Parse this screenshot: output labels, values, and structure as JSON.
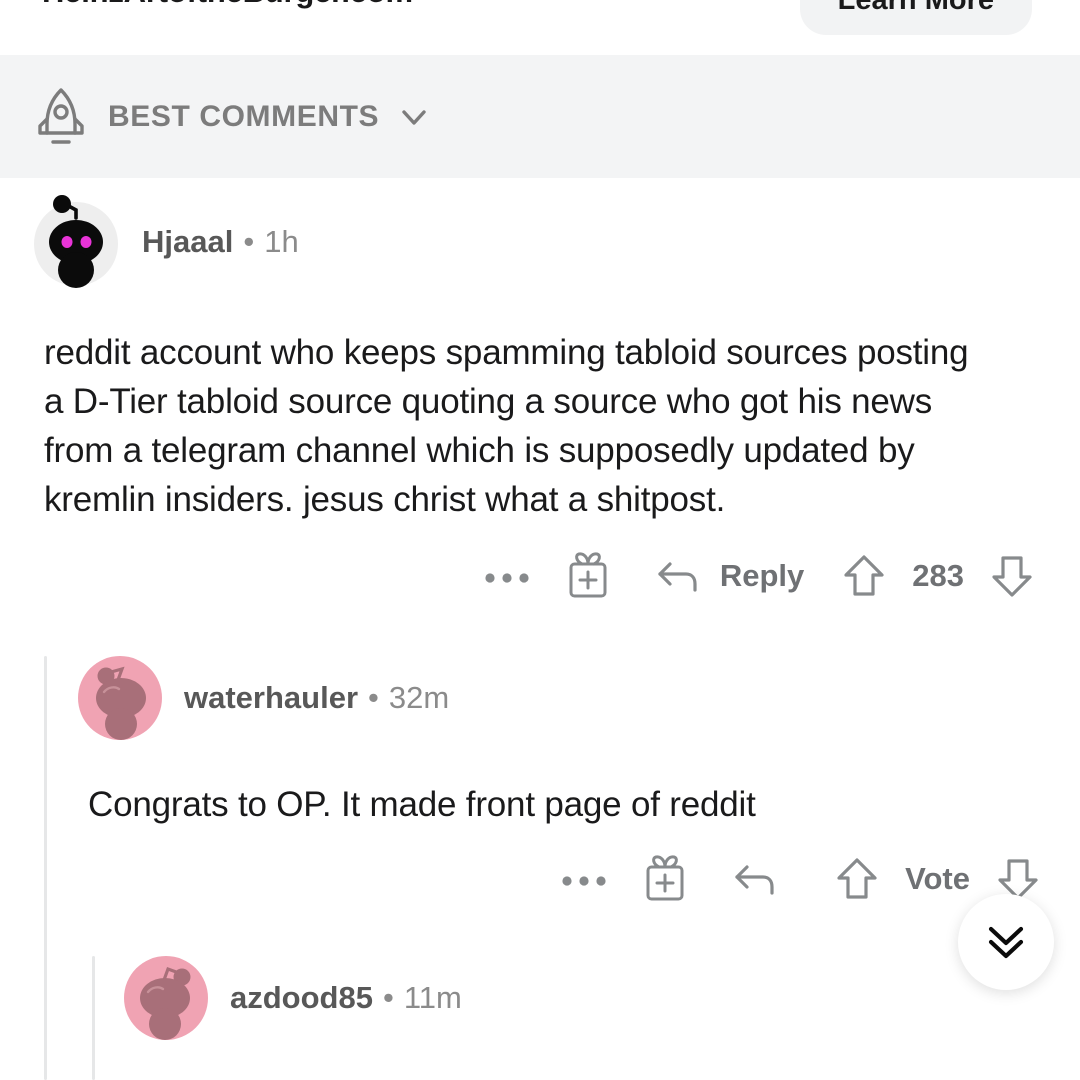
{
  "promo": {
    "domain": "HeinzArtoftheBurger.com",
    "cta_label": "Learn More"
  },
  "sort_header": {
    "icon": "rocket-icon",
    "label": "BEST COMMENTS",
    "chevron": "chevron-down-icon"
  },
  "colors": {
    "header_background": "#f3f4f5",
    "page_background": "#ffffff",
    "thread_line": "#e6e7e8",
    "icon_gray": "#878a8c",
    "text_primary": "#1a1a1b",
    "username_gray": "#585858",
    "timestamp_gray": "#8b8b8b",
    "avatar_dark": "#0b0b0b",
    "avatar_eyes": "#e934d8",
    "avatar_pink_bg": "#f0a3b3",
    "avatar_pink_body": "#a86f79"
  },
  "comments": [
    {
      "id": "comment-hjaaal",
      "depth": 0,
      "avatar": "snoo-avatar-black",
      "username": "Hjaaal",
      "separator": "•",
      "timestamp": "1h",
      "body": "reddit account who keeps spamming tabloid sources posting a D-Tier tabloid source quoting a source who got his news from a telegram channel which is supposedly updated by kremlin insiders. jesus christ what a shitpost.",
      "actions": {
        "overflow": "…",
        "award_icon": "gift-icon",
        "reply_icon": "reply-arrow-icon",
        "reply_label": "Reply",
        "upvote_icon": "upvote-arrow-icon",
        "score": "283",
        "downvote_icon": "downvote-arrow-icon"
      }
    },
    {
      "id": "comment-waterhauler",
      "depth": 1,
      "avatar": "snoo-avatar-pink",
      "username": "waterhauler",
      "separator": "•",
      "timestamp": "32m",
      "body": "Congrats to OP. It made front page of reddit",
      "actions": {
        "overflow": "…",
        "award_icon": "gift-icon",
        "reply_icon": "reply-arrow-icon",
        "reply_label": "",
        "upvote_icon": "upvote-arrow-icon",
        "score": "Vote",
        "downvote_icon": "downvote-arrow-icon"
      }
    },
    {
      "id": "comment-azdood85",
      "depth": 2,
      "avatar": "snoo-avatar-pink",
      "username": "azdood85",
      "separator": "•",
      "timestamp": "11m",
      "body": "",
      "actions": null
    }
  ],
  "floating_button": {
    "icon": "double-chevron-down-icon",
    "purpose": "next-comment-thread"
  }
}
